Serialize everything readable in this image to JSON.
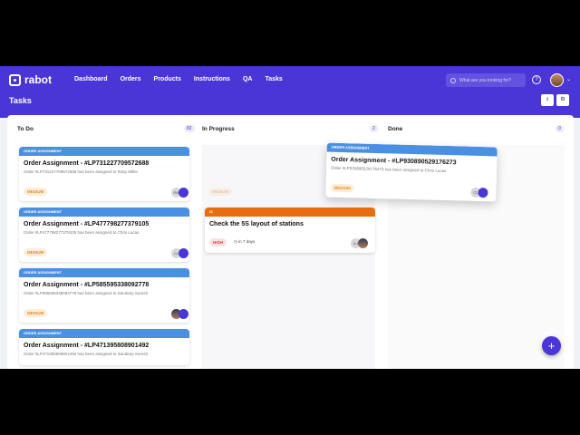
{
  "app": {
    "brand": "rabot",
    "page_title": "Tasks",
    "nav": [
      "Dashboard",
      "Orders",
      "Products",
      "Instructions",
      "QA",
      "Tasks"
    ],
    "search_placeholder": "What are you looking for?",
    "help": "?",
    "chevron": "⌄",
    "tool_download": "⭳",
    "tool_settings": "⚙"
  },
  "columns": [
    {
      "title": "To Do",
      "count": "82"
    },
    {
      "title": "In Progress",
      "count": "2"
    },
    {
      "title": "Done",
      "count": "0"
    }
  ],
  "todo": [
    {
      "tag": "ORDER ASSIGNMENT",
      "title": "Order Assignment - #LP731227709572688",
      "sub": "Order #LP731227709572688 has been assigned to Roby Miller",
      "priority": "MEDIUM",
      "initials": "RM"
    },
    {
      "tag": "ORDER ASSIGNMENT",
      "title": "Order Assignment - #LP477798277379105",
      "sub": "Order #LP477798277379105 has been assigned to Chris Lucas",
      "priority": "MEDIUM",
      "initials": "CL"
    },
    {
      "tag": "ORDER ASSIGNMENT",
      "title": "Order Assignment - #LP585595338092778",
      "sub": "Order #LP585595338092778 has been assigned to Sandeep Suresh",
      "priority": "MEDIUM",
      "initials": ""
    },
    {
      "tag": "ORDER ASSIGNMENT",
      "title": "Order Assignment - #LP471395808901492",
      "sub": "Order #LP471395808901492 has been assigned to Sandeep Suresh",
      "priority": "",
      "initials": ""
    }
  ],
  "inprogress": [
    {
      "tag": "IS",
      "title": "Check the 5S layout of stations",
      "priority": "HIGH",
      "due": "in 7 days",
      "initials": "AJ"
    }
  ],
  "ghost_priority": "MEDIUM",
  "dragging": {
    "tag": "ORDER ASSIGNMENT",
    "title": "Order Assignment - #LP930890529176273",
    "sub": "Order #LP930890529176273 has been assigned to Chris Lucas",
    "priority": "MEDIUM",
    "initials": "CL"
  },
  "fab": "+",
  "colors": {
    "brand": "#4a36d6",
    "tag_blue": "#4a90e2",
    "tag_orange": "#e86d10"
  }
}
